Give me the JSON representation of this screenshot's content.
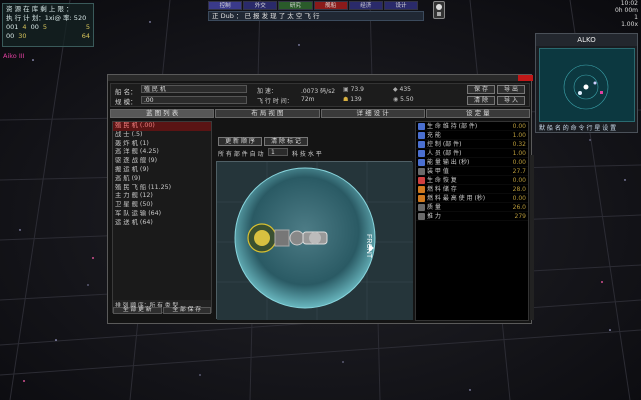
{
  "hud": {
    "line1": "资 源 在 库 剩 上 限 ：",
    "line2": "执 行 计 划：1xi@ 率: 520",
    "res": [
      {
        "label": "001",
        "value": "4"
      },
      {
        "label": "00",
        "value": "5"
      },
      {
        "label": "00",
        "value": "30"
      }
    ],
    "res_r1": "5",
    "res_r2": "64",
    "player_name": "Aiko III"
  },
  "topbar": {
    "buttons": [
      "控制",
      "外交",
      "研究",
      "舰船",
      "经济",
      "设计"
    ],
    "colors": [
      "#3a3a8a",
      "#2a2a6a",
      "#2a5a2a",
      "#8a1a1a",
      "#2a2a6a",
      "#2a2a6a"
    ],
    "status": "正 Dub ： 已 报 发 现 了 太 空 飞 行"
  },
  "time": {
    "clock": "10:02",
    "elapsed": "0h 00m",
    "date": "1",
    "speed": "1.00x"
  },
  "minimap": {
    "title": "ALKO",
    "footer": "默 船 名 的 命 令 行 星 设 置"
  },
  "window": {
    "name_label": "船 名：",
    "name_value": "殖 民 机",
    "class_label": "规 模：",
    "class_value": ".00",
    "speed_label": "加 速：",
    "speed_value": ".0073 码/s2",
    "flight_label": "飞 行 时 间：",
    "flight_value": "72m",
    "stat1": "73.9",
    "stat2": "435",
    "stat3": "139",
    "stat4": "5.50",
    "btn_save": "保 存",
    "btn_export": "导 出",
    "btn_clear": "清 除",
    "btn_import": "导 入"
  },
  "tabs": [
    "蓝 图 列 表",
    "布 局 视 图",
    "详 细 设 计",
    "设 定 量"
  ],
  "list": {
    "items": [
      "殖 民 机 (.00)",
      "战 士 (.5)",
      "轰 炸 机 (1)",
      "巡 洋 舰 (4.25)",
      "驱 逐 战 舰 (9)",
      "搬 运 机 (9)",
      "巡 航 (9)",
      "殖 民 飞 船 (11.25)",
      "主 力 舰 (12)",
      "卫 星 舰 (50)",
      "军 队 运 输 (64)",
      "运 送 机 (64)"
    ],
    "sort": "排 列 顺 序：所 有 类 型",
    "btn_update": "全 部 更 新",
    "btn_save_all": "全 部 保 存"
  },
  "center": {
    "btn_order": "更 新 顺 序",
    "btn_mark": "清 除 标 记",
    "scale_label": "所 有 部 件 自 动",
    "scale_value": "1",
    "scale_unit": "科 技 水 平",
    "front_label": "FRONT"
  },
  "stats": [
    {
      "label": "生 命 维 持 (部 件)",
      "value": "0.00",
      "color": "#4a6fd0"
    },
    {
      "label": "充 能",
      "value": "1.00",
      "color": "#4a6fd0"
    },
    {
      "label": "控 制 (部 件)",
      "value": "0.32",
      "color": "#4a6fd0"
    },
    {
      "label": "人 员 (部 件)",
      "value": "1.00",
      "color": "#4a6fd0"
    },
    {
      "label": "能 量 输 出 (秒)",
      "value": "0.00",
      "color": "#4a6fd0"
    },
    {
      "label": "装 甲 值",
      "value": "27.7",
      "color": "#6a6a6a"
    },
    {
      "label": "生 命 恢 复",
      "value": "0.00",
      "color": "#d04040"
    },
    {
      "label": "燃 料 储 存",
      "value": "28.0",
      "color": "#d07a20"
    },
    {
      "label": "燃 料 最 高 使 用 (秒)",
      "value": "0.00",
      "color": "#d07a20"
    },
    {
      "label": "质 量",
      "value": "26.0",
      "color": "#6a6a6a"
    },
    {
      "label": "推 力",
      "value": "279",
      "color": "#6a6a6a"
    }
  ]
}
